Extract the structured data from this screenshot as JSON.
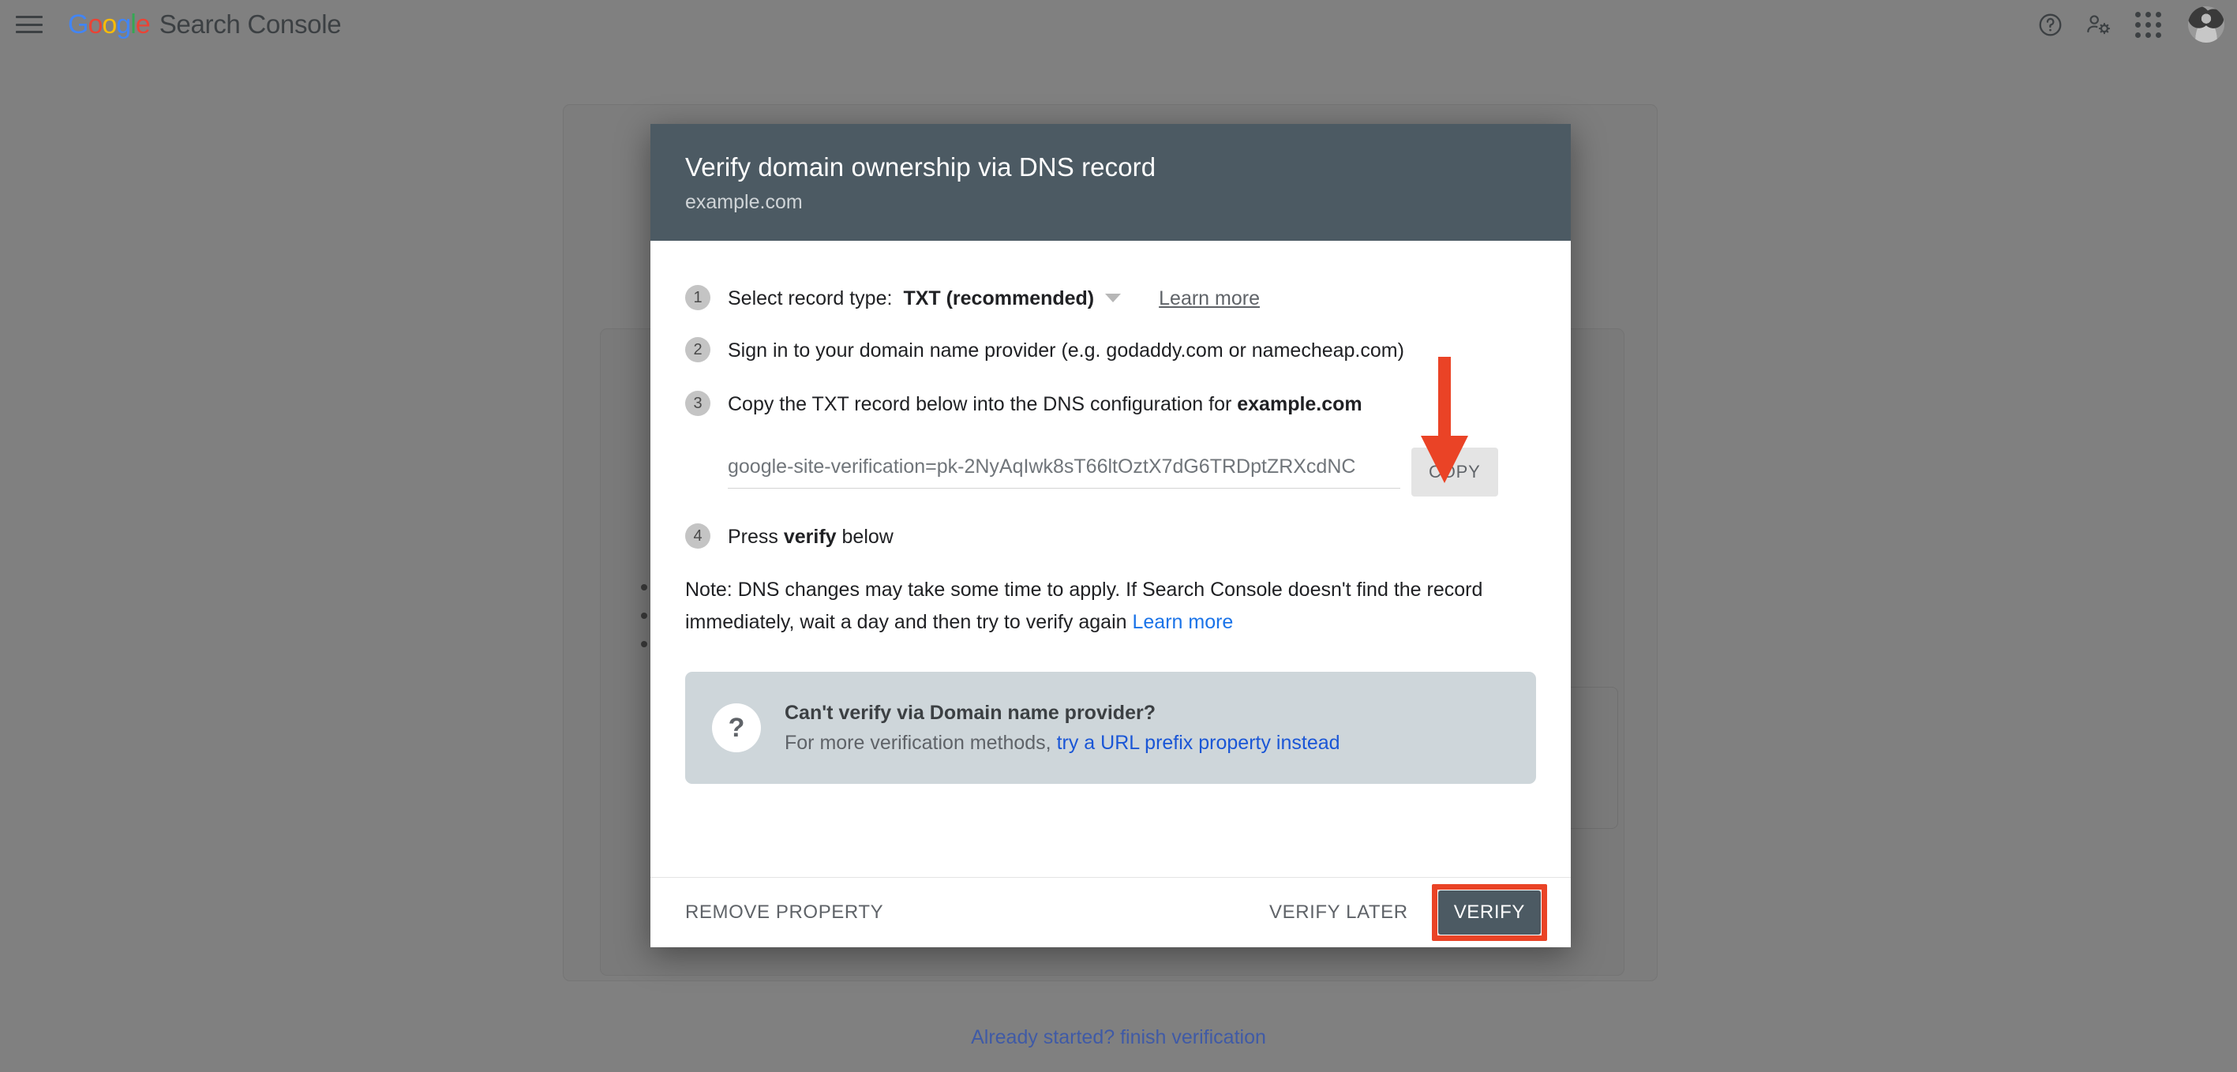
{
  "header": {
    "menu_icon": "hamburger-menu-icon",
    "logo_google": "Google",
    "logo_letters": [
      "G",
      "o",
      "o",
      "g",
      "l",
      "e"
    ],
    "product_name": "Search Console",
    "help_icon": "help-circle-icon",
    "account_settings_icon": "account-settings-icon",
    "apps_icon": "apps-grid-icon",
    "avatar_icon": "user-avatar"
  },
  "dialog": {
    "title": "Verify domain ownership via DNS record",
    "subtitle": "example.com",
    "steps": [
      {
        "number": "1",
        "label": "Select record type:",
        "select_value": "TXT (recommended)",
        "caret_icon": "chevron-down-icon",
        "learn_more": "Learn more"
      },
      {
        "number": "2",
        "text": "Sign in to your domain name provider (e.g. godaddy.com or namecheap.com)"
      },
      {
        "number": "3",
        "text_before": "Copy the TXT record below into the DNS configuration for ",
        "text_bold": "example.com"
      },
      {
        "number": "4",
        "text_before": "Press ",
        "text_bold": "verify",
        "text_after": " below"
      }
    ],
    "txt_record": "google-site-verification=pk-2NyAqIwk8sT66ltOztX7dG6TRDptZRXcdNC",
    "copy_button": "COPY",
    "note": {
      "text": "Note: DNS changes may take some time to apply. If Search Console doesn't find the record immediately, wait a day and then try to verify again ",
      "link": "Learn more"
    },
    "infobox": {
      "icon": "question-mark-icon",
      "title": "Can't verify via Domain name provider?",
      "text": "For more verification methods, ",
      "link": "try a URL prefix property instead"
    },
    "footer": {
      "remove_property": "REMOVE PROPERTY",
      "verify_later": "VERIFY LATER",
      "verify": "VERIFY"
    }
  },
  "page": {
    "bottom_link": "Already started? finish verification"
  },
  "annotations": {
    "arrow_icon": "red-down-arrow-annotation",
    "highlight_icon": "red-highlight-box-annotation"
  },
  "colors": {
    "page_background": "#808080",
    "dialog_header": "#4c5a63",
    "annotation_red": "#ea4326",
    "link_blue": "#1a73e8",
    "infobox_background": "#ced6da"
  }
}
